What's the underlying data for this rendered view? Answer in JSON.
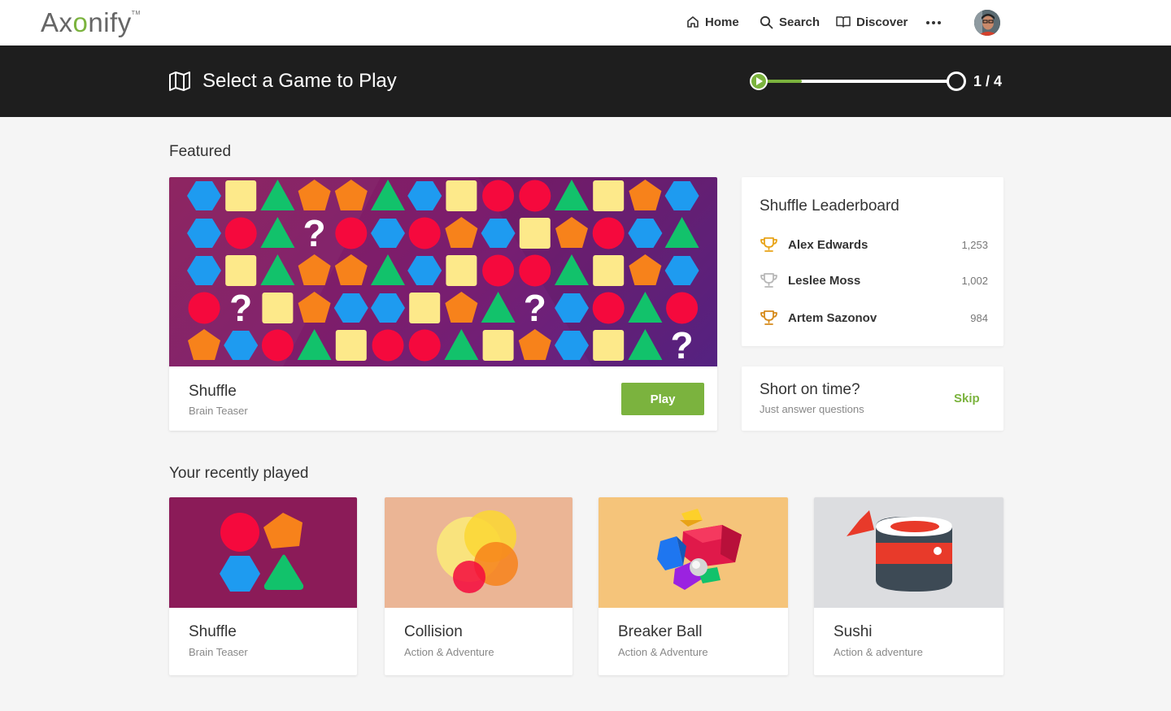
{
  "brand": {
    "name_prefix": "Ax",
    "name_o": "o",
    "name_suffix": "nify",
    "tm": "TM"
  },
  "nav": {
    "home": "Home",
    "search": "Search",
    "discover": "Discover"
  },
  "header": {
    "title": "Select a Game to Play",
    "progress_text": "1 / 4",
    "progress_fraction": 0.25
  },
  "featured": {
    "section_title": "Featured",
    "game_title": "Shuffle",
    "game_category": "Brain Teaser",
    "play_label": "Play"
  },
  "leaderboard": {
    "title": "Shuffle Leaderboard",
    "entries": [
      {
        "name": "Alex Edwards",
        "score": "1,253",
        "trophy": "gold-trophy-icon"
      },
      {
        "name": "Leslee Moss",
        "score": "1,002",
        "trophy": "silver-trophy-icon"
      },
      {
        "name": "Artem Sazonov",
        "score": "984",
        "trophy": "bronze-trophy-icon"
      }
    ]
  },
  "short_on_time": {
    "title": "Short on time?",
    "subtitle": "Just answer questions",
    "skip_label": "Skip"
  },
  "recent": {
    "section_title": "Your recently played",
    "games": [
      {
        "title": "Shuffle",
        "category": "Brain Teaser"
      },
      {
        "title": "Collision",
        "category": "Action & Adventure"
      },
      {
        "title": "Breaker Ball",
        "category": "Action & Adventure"
      },
      {
        "title": "Sushi",
        "category": "Action & adventure"
      }
    ]
  },
  "colors": {
    "accent": "#7bb33e",
    "header_bg": "#1e1e1e",
    "shape_blue": "#1e9bf0",
    "shape_yellow": "#fde98a",
    "shape_green": "#12c26b",
    "shape_orange": "#f7821b",
    "shape_red": "#f5093d"
  }
}
